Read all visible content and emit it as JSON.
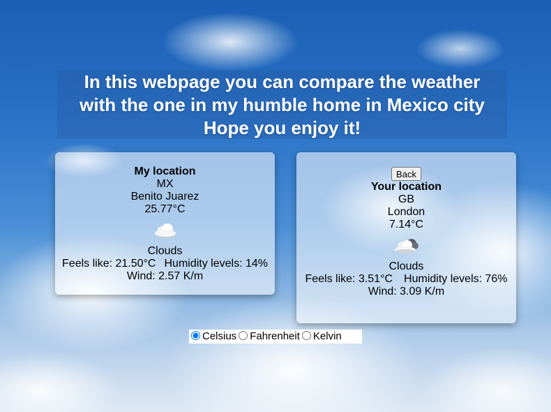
{
  "header": {
    "line1": "In this webpage you can compare the weather",
    "line2": "with the one in my humble home in Mexico city",
    "line3": "Hope you enjoy it!"
  },
  "my_location": {
    "title": "My location",
    "country": "MX",
    "city": "Benito Juarez",
    "temperature": "25.77°C",
    "icon": "cloud-icon",
    "description": "Clouds",
    "feels_like": "Feels like: 21.50°C",
    "humidity": "Humidity levels: 14%",
    "wind": "Wind: 2.57 K/m"
  },
  "your_location": {
    "back_label": "Back",
    "title": "Your location",
    "country": "GB",
    "city": "London",
    "temperature": "7.14°C",
    "icon": "cloud-overcast-icon",
    "description": "Clouds",
    "feels_like": "Feels like: 3.51°C",
    "humidity": "Humidity levels: 76%",
    "wind": "Wind: 3.09 K/m"
  },
  "units": {
    "options": [
      "Celsius",
      "Fahrenheit",
      "Kelvin"
    ],
    "selected": "Celsius"
  }
}
